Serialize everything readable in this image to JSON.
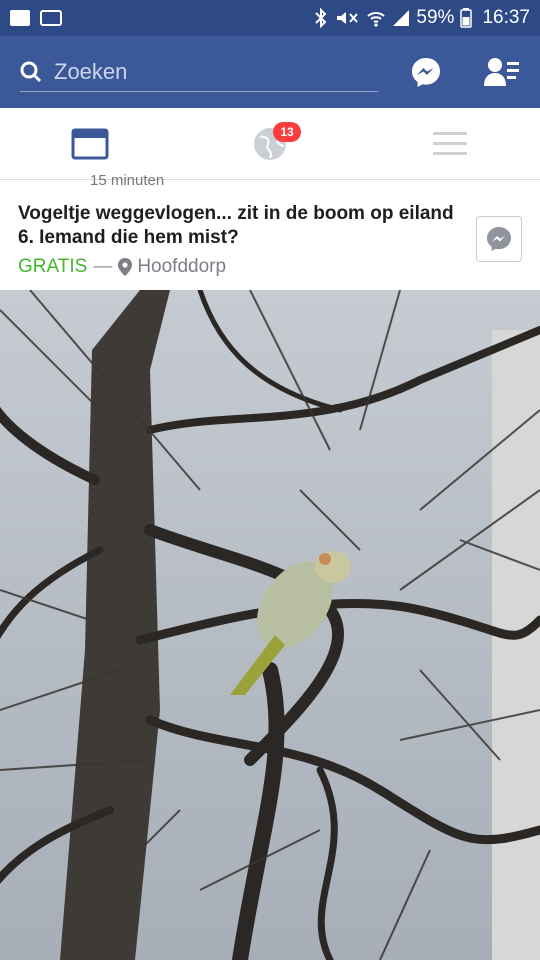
{
  "status_bar": {
    "battery": "59%",
    "time": "16:37",
    "left_icons": [
      "outlook-icon",
      "mail-icon"
    ],
    "right_icons": [
      "bluetooth-icon",
      "mute-icon",
      "wifi-icon",
      "signal-icon",
      "battery-icon"
    ]
  },
  "header": {
    "search_placeholder": "Zoeken",
    "icons": [
      "search-icon",
      "messenger-icon",
      "friend-requests-icon"
    ]
  },
  "tabs": {
    "items": [
      {
        "name": "news-feed",
        "icon": "news-feed-icon",
        "active": true
      },
      {
        "name": "notifications",
        "icon": "globe-icon",
        "badge": "13"
      },
      {
        "name": "menu",
        "icon": "menu-icon"
      }
    ]
  },
  "post": {
    "title": "Vogeltje weggevlogen... zit in de boom op eiland 6. Iemand die hem mist?",
    "price": "GRATIS",
    "separator": "—",
    "location": "Hoofddorp",
    "cut_text": "15 minuten"
  },
  "colors": {
    "status_bar": "#2d4a87",
    "header": "#3b5998",
    "price": "#42b72a",
    "badge": "#fa3e3e",
    "tab_active": "#3b5998",
    "tab_inactive": "#ccd0d5"
  }
}
